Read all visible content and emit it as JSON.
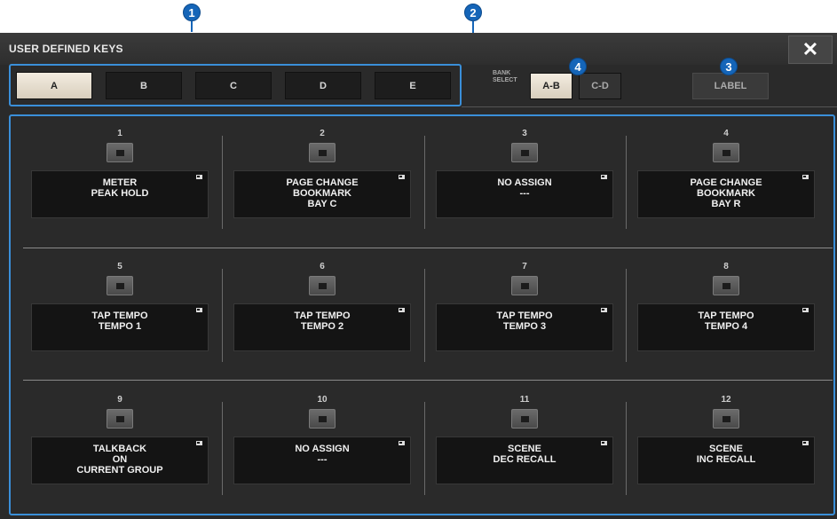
{
  "callouts": [
    "1",
    "2",
    "3",
    "4"
  ],
  "window": {
    "title": "USER DEFINED KEYS",
    "close_label": "✕"
  },
  "tabs": [
    {
      "label": "A",
      "active": true
    },
    {
      "label": "B",
      "active": false
    },
    {
      "label": "C",
      "active": false
    },
    {
      "label": "D",
      "active": false
    },
    {
      "label": "E",
      "active": false
    }
  ],
  "bank_select": {
    "label_line1": "BANK",
    "label_line2": "SELECT",
    "options": [
      {
        "label": "A-B",
        "active": true
      },
      {
        "label": "C-D",
        "active": false
      }
    ]
  },
  "label_button": "LABEL",
  "keys": [
    {
      "num": "1",
      "func": "METER\nPEAK HOLD"
    },
    {
      "num": "2",
      "func": "PAGE CHANGE\nBOOKMARK\nBAY C"
    },
    {
      "num": "3",
      "func": "NO ASSIGN\n---"
    },
    {
      "num": "4",
      "func": "PAGE CHANGE\nBOOKMARK\nBAY R"
    },
    {
      "num": "5",
      "func": "TAP TEMPO\nTEMPO 1"
    },
    {
      "num": "6",
      "func": "TAP TEMPO\nTEMPO 2"
    },
    {
      "num": "7",
      "func": "TAP TEMPO\nTEMPO 3"
    },
    {
      "num": "8",
      "func": "TAP TEMPO\nTEMPO 4"
    },
    {
      "num": "9",
      "func": "TALKBACK\nON\nCURRENT GROUP"
    },
    {
      "num": "10",
      "func": "NO ASSIGN\n---"
    },
    {
      "num": "11",
      "func": "SCENE\nDEC RECALL"
    },
    {
      "num": "12",
      "func": "SCENE\nINC RECALL"
    }
  ],
  "colors": {
    "accent": "#3a8fd9",
    "callout": "#1565b8",
    "panel": "#2a2a2a",
    "active_button": "#e8e0d0"
  }
}
